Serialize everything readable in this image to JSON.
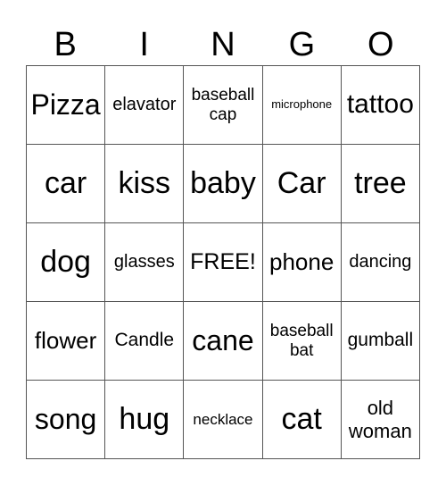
{
  "header": [
    "B",
    "I",
    "N",
    "G",
    "O"
  ],
  "rows": [
    [
      {
        "text": "Pizza",
        "size": 32
      },
      {
        "text": "elavator",
        "size": 20
      },
      {
        "text": "baseball cap",
        "size": 19
      },
      {
        "text": "microphone",
        "size": 13
      },
      {
        "text": "tattoo",
        "size": 30
      }
    ],
    [
      {
        "text": "car",
        "size": 34
      },
      {
        "text": "kiss",
        "size": 34
      },
      {
        "text": "baby",
        "size": 34
      },
      {
        "text": "Car",
        "size": 34
      },
      {
        "text": "tree",
        "size": 34
      }
    ],
    [
      {
        "text": "dog",
        "size": 34
      },
      {
        "text": "glasses",
        "size": 20
      },
      {
        "text": "FREE!",
        "size": 25
      },
      {
        "text": "phone",
        "size": 26
      },
      {
        "text": "dancing",
        "size": 20
      }
    ],
    [
      {
        "text": "flower",
        "size": 26
      },
      {
        "text": "Candle",
        "size": 21
      },
      {
        "text": "cane",
        "size": 32
      },
      {
        "text": "baseball bat",
        "size": 19
      },
      {
        "text": "gumball",
        "size": 21
      }
    ],
    [
      {
        "text": "song",
        "size": 32
      },
      {
        "text": "hug",
        "size": 34
      },
      {
        "text": "necklace",
        "size": 17
      },
      {
        "text": "cat",
        "size": 34
      },
      {
        "text": "old woman",
        "size": 22
      }
    ]
  ]
}
